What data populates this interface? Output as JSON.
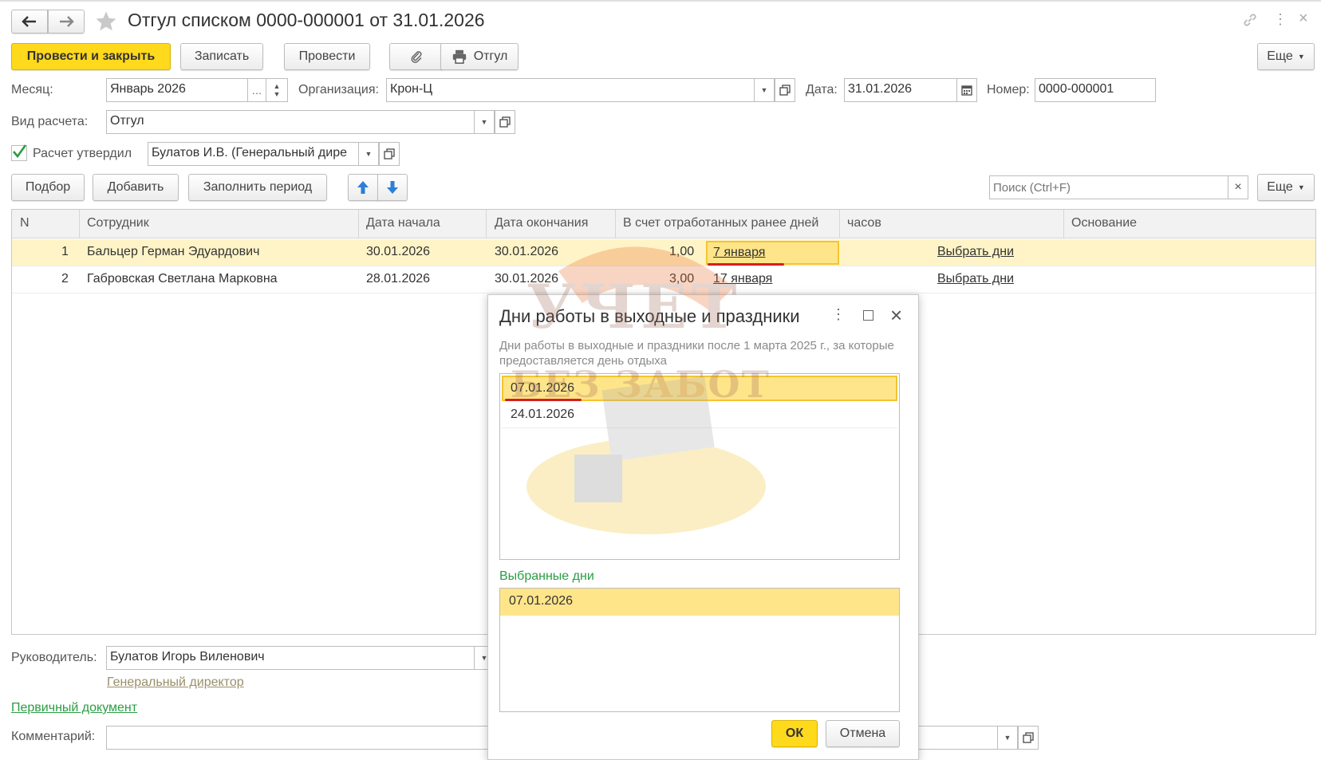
{
  "window": {
    "title": "Отгул списком 0000-000001 от 31.01.2026"
  },
  "toolbar": {
    "post_close": "Провести и закрыть",
    "save": "Записать",
    "post": "Провести",
    "print": "Отгул",
    "more": "Еще"
  },
  "header": {
    "month_label": "Месяц:",
    "month_value": "Январь 2026",
    "org_label": "Организация:",
    "org_value": "Крон-Ц",
    "date_label": "Дата:",
    "date_value": "31.01.2026",
    "number_label": "Номер:",
    "number_value": "0000-000001",
    "calc_type_label": "Вид расчета:",
    "calc_type_value": "Отгул",
    "approved_label": "Расчет утвердил",
    "approved_checked": true,
    "approved_value": "Булатов И.В. (Генеральный дире"
  },
  "table_toolbar": {
    "pick": "Подбор",
    "add": "Добавить",
    "fill_period": "Заполнить период",
    "search_placeholder": "Поиск (Ctrl+F)",
    "more": "Еще"
  },
  "table": {
    "columns": [
      "N",
      "Сотрудник",
      "Дата начала",
      "Дата окончания",
      "В счет отработанных ранее дней",
      "часов",
      "Основание"
    ],
    "rows": [
      {
        "n": "1",
        "employee": "Бальцер Герман Эдуардович",
        "start": "30.01.2026",
        "end": "30.01.2026",
        "days": "1,00",
        "worked_date": "7 января",
        "pick": "Выбрать дни",
        "selected": true
      },
      {
        "n": "2",
        "employee": "Габровская Светлана Марковна",
        "start": "28.01.2026",
        "end": "30.01.2026",
        "days": "3,00",
        "worked_date": "17 января",
        "pick": "Выбрать дни",
        "selected": false
      }
    ]
  },
  "footer": {
    "manager_label": "Руководитель:",
    "manager_value": "Булатов Игорь Виленович",
    "manager_position": "Генеральный директор",
    "primary_doc": "Первичный документ",
    "comment_label": "Комментарий:"
  },
  "dialog": {
    "title": "Дни работы в выходные и праздники",
    "description": "Дни работы в выходные и праздники после 1 марта 2025 г., за которые предоставляется день отдыха",
    "days": [
      "07.01.2026",
      "24.01.2026"
    ],
    "selected_label": "Выбранные дни",
    "selected_days": [
      "07.01.2026"
    ],
    "ok": "ОК",
    "cancel": "Отмена"
  },
  "watermark": {
    "line1": "УЧЕТ",
    "line2": "БЕЗ ЗАБОТ"
  },
  "colors": {
    "accent": "#ffd91c",
    "row_highlight": "#fff4c7",
    "link_green": "#2a9d43",
    "underline_red": "#d32020"
  }
}
